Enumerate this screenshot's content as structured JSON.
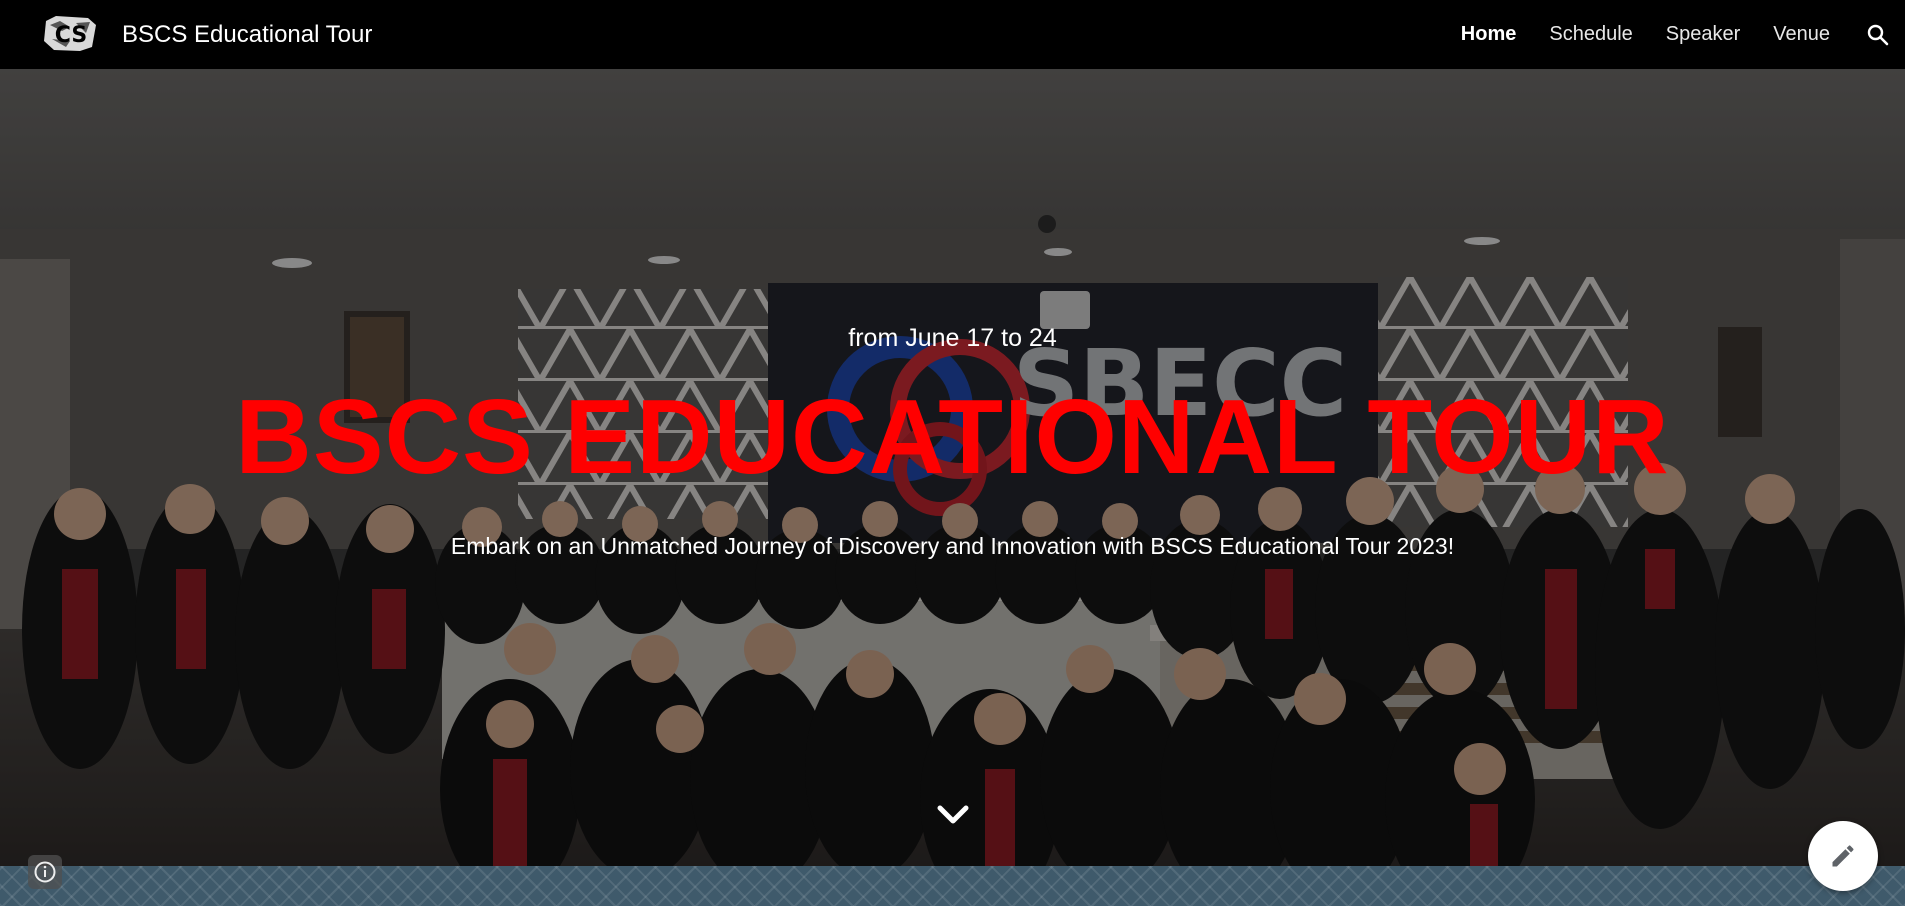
{
  "header": {
    "site_title": "BSCS Educational Tour",
    "logo_text": "CS",
    "nav": [
      {
        "label": "Home",
        "active": true
      },
      {
        "label": "Schedule",
        "active": false
      },
      {
        "label": "Speaker",
        "active": false
      },
      {
        "label": "Venue",
        "active": false
      }
    ],
    "search_icon": "search-icon"
  },
  "hero": {
    "date_text": "from June 17 to 24",
    "title": "BSCS EDUCATIONAL TOUR",
    "tagline": "Embark on an Unmatched Journey of Discovery and Innovation with BSCS Educational Tour 2023!",
    "background_sign_text": "SBECC",
    "scroll_icon": "chevron-down-icon",
    "title_color": "#ff0000"
  },
  "footer": {
    "info_icon": "info-icon",
    "edit_icon": "pencil-icon"
  },
  "colors": {
    "header_bg": "#000000",
    "footer_band": "#3f5a6b"
  }
}
